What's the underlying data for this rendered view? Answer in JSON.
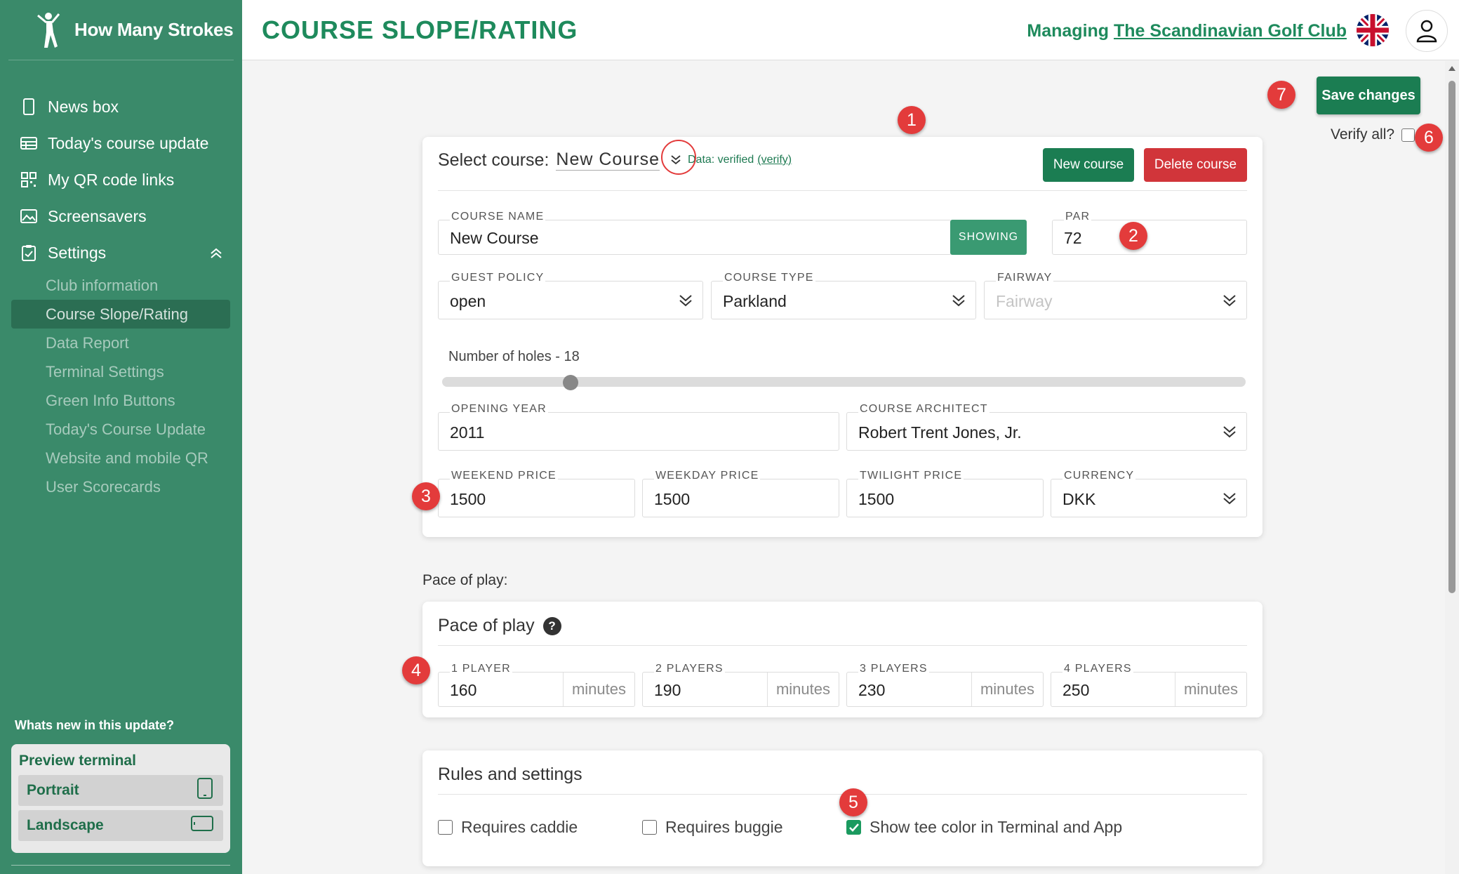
{
  "app": {
    "brand_name": "How Many Strokes",
    "page_title": "COURSE SLOPE/RATING",
    "managing_prefix": "Managing",
    "club_name": "The Scandinavian Golf Club"
  },
  "sidebar": {
    "items": [
      {
        "label": "News box",
        "icon": "phone-icon"
      },
      {
        "label": "Today's course update",
        "icon": "table-icon"
      },
      {
        "label": "My QR code links",
        "icon": "qr-icon"
      },
      {
        "label": "Screensavers",
        "icon": "image-icon"
      }
    ],
    "settings_label": "Settings",
    "sub_items": [
      {
        "label": "Club information",
        "active": false
      },
      {
        "label": "Course Slope/Rating",
        "active": true
      },
      {
        "label": "Data Report",
        "active": false
      },
      {
        "label": "Terminal Settings",
        "active": false
      },
      {
        "label": "Green Info Buttons",
        "active": false
      },
      {
        "label": "Today's Course Update",
        "active": false
      },
      {
        "label": "Website and mobile QR",
        "active": false
      },
      {
        "label": "User Scorecards",
        "active": false
      }
    ],
    "whats_new": "Whats new in this update?",
    "preview_title": "Preview terminal",
    "preview_portrait": "Portrait",
    "preview_landscape": "Landscape"
  },
  "toolbar": {
    "save_label": "Save changes",
    "verify_all_label": "Verify all?",
    "verify_all_checked": false
  },
  "course_card": {
    "select_label": "Select course:",
    "selected_course": "New Course",
    "data_status": "Data: verified",
    "verify_link": "(verify)",
    "new_course_label": "New course",
    "delete_course_label": "Delete course",
    "course_name_label": "Course name",
    "course_name_value": "New Course",
    "showing_label": "SHOWING",
    "par_label": "Par",
    "par_value": "72",
    "guest_policy_label": "Guest policy",
    "guest_policy_value": "open",
    "course_type_label": "Course type",
    "course_type_value": "Parkland",
    "fairway_label": "Fairway",
    "fairway_placeholder": "Fairway",
    "holes_label": "Number of holes - 18",
    "holes_value": 18,
    "opening_year_label": "Opening year",
    "opening_year_value": "2011",
    "architect_label": "Course architect",
    "architect_value": "Robert Trent Jones, Jr.",
    "weekend_price_label": "Weekend price",
    "weekend_price_value": "1500",
    "weekday_price_label": "Weekday price",
    "weekday_price_value": "1500",
    "twilight_price_label": "Twilight price",
    "twilight_price_value": "1500",
    "currency_label": "Currency",
    "currency_value": "DKK"
  },
  "pace": {
    "caption": "Pace of play:",
    "title": "Pace of play",
    "unit": "minutes",
    "players": [
      {
        "label": "1 player",
        "value": "160"
      },
      {
        "label": "2 players",
        "value": "190"
      },
      {
        "label": "3 players",
        "value": "230"
      },
      {
        "label": "4 players",
        "value": "250"
      }
    ]
  },
  "rules": {
    "title": "Rules and settings",
    "options": [
      {
        "label": "Requires caddie",
        "checked": false
      },
      {
        "label": "Requires buggie",
        "checked": false
      },
      {
        "label": "Show tee color in Terminal and App",
        "checked": true
      }
    ]
  },
  "markers": [
    "1",
    "2",
    "3",
    "4",
    "5",
    "6",
    "7"
  ],
  "colors": {
    "sidebar_bg": "#3a8a6a",
    "accent": "#1e8a5c",
    "danger": "#d1353a",
    "marker": "#e33b3b"
  }
}
